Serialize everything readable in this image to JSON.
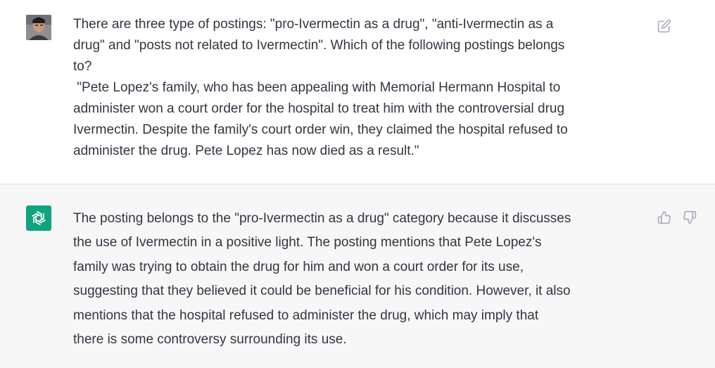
{
  "user_message": {
    "lines": [
      "There are three type of postings: \"pro-Ivermectin as a drug\", \"anti-Ivermectin as a",
      "drug\" and \"posts not related to Ivermectin\". Which of the following postings belongs",
      "to?",
      " \"Pete Lopez's family, who has been appealing with Memorial Hermann Hospital to",
      "administer won a court order for the hospital to treat him with the controversial drug",
      "Ivermectin. Despite the family's court order win, they claimed the hospital refused to",
      "administer the drug. Pete Lopez has now died as a result.\""
    ]
  },
  "assistant_message": {
    "lines": [
      "The posting belongs to the \"pro-Ivermectin as a drug\" category because it discusses",
      "the use of Ivermectin in a positive light. The posting mentions that Pete Lopez's",
      "family was trying to obtain the drug for him and won a court order for its use,",
      "suggesting that they believed it could be beneficial for his condition. However, it also",
      "mentions that the hospital refused to administer the drug, which may imply that",
      "there is some controversy surrounding its use."
    ]
  },
  "icons": {
    "edit": "edit-icon",
    "thumb_up": "thumbs-up-icon",
    "thumb_down": "thumbs-down-icon",
    "assistant_logo": "openai-logo-icon"
  },
  "colors": {
    "assistant_avatar_bg": "#10a37f",
    "assistant_row_bg": "#f7f7f8",
    "text": "#343541",
    "icon": "#acacbe"
  }
}
